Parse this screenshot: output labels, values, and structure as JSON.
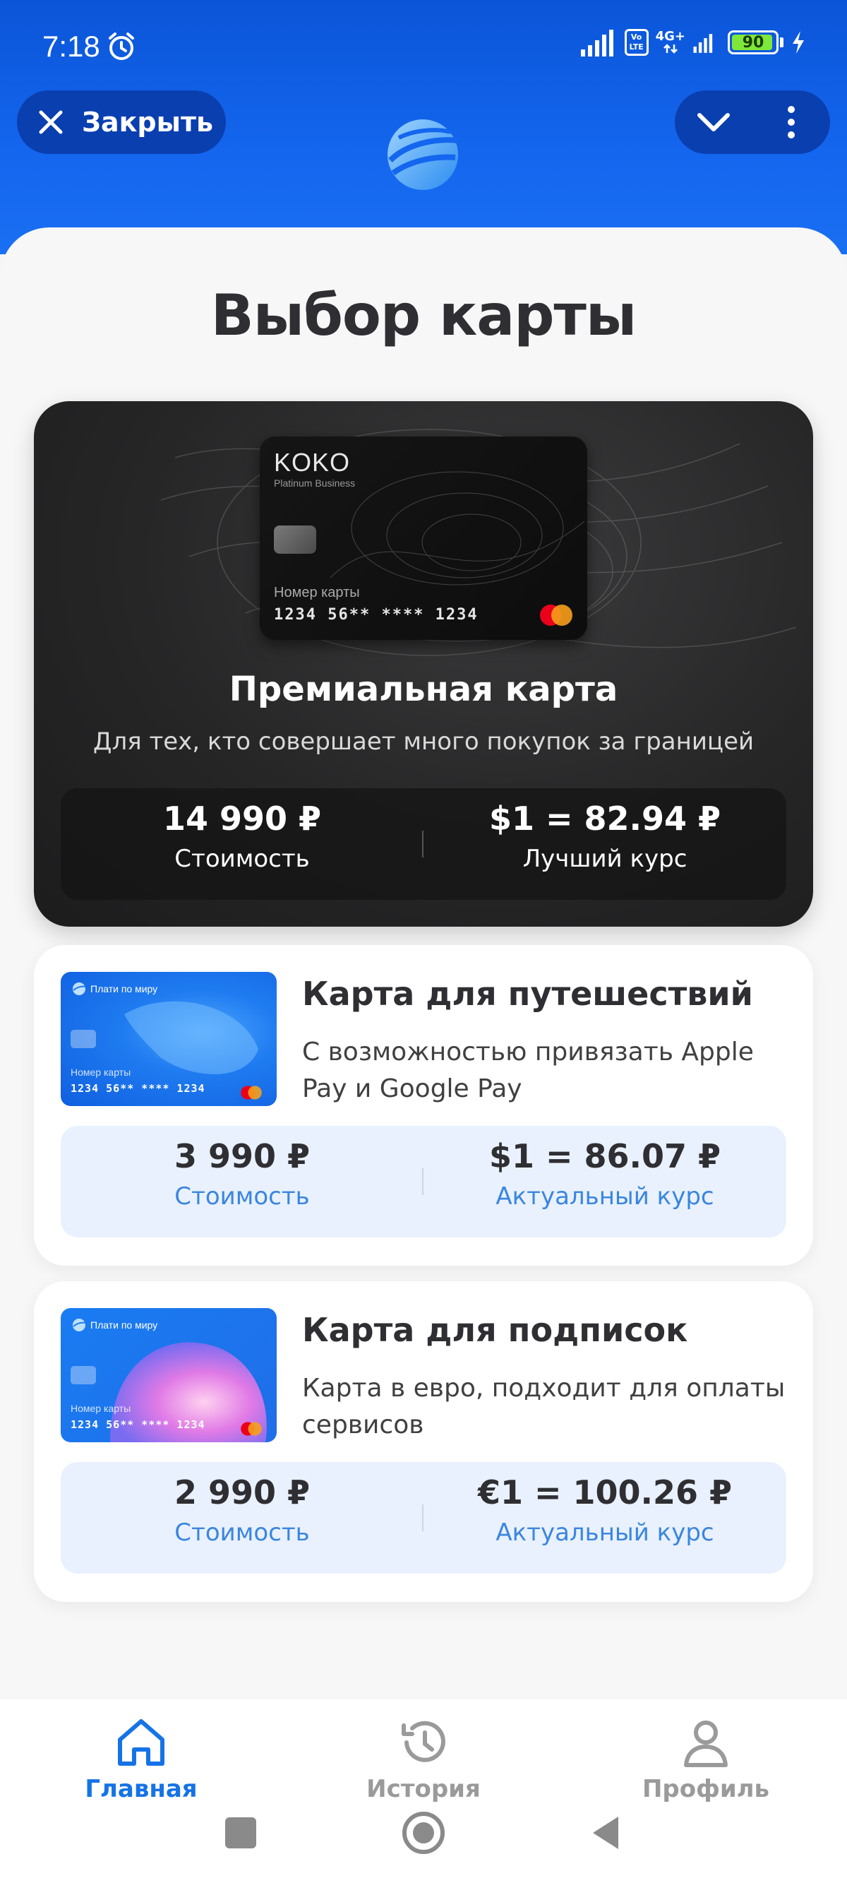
{
  "status_bar": {
    "time": "7:18",
    "network": "4G+",
    "volte": "Vo LTE",
    "battery": "90"
  },
  "header": {
    "close_label": "Закрыть",
    "accent": "#1466ee"
  },
  "page_title": "Выбор карты",
  "premium": {
    "card_brand": "KOKO",
    "card_tier": "Platinum Business",
    "card_number_label": "Номер карты",
    "card_number": "1234 56** **** 1234",
    "title": "Премиальная карта",
    "description": "Для тех, кто совершает много покупок за границей",
    "price": "14 990 ₽",
    "price_label": "Стоимость",
    "rate": "$1 = 82.94 ₽",
    "rate_label": "Лучший курс"
  },
  "offers": [
    {
      "thumb_brand": "Плати по миру",
      "thumb_number_label": "Номер карты",
      "thumb_number": "1234 56** **** 1234",
      "title": "Карта для путешествий",
      "description": "С возможностью привязать Apple Pay и Google Pay",
      "price": "3 990 ₽",
      "price_label": "Стоимость",
      "rate": "$1 = 86.07 ₽",
      "rate_label": "Актуальный курс"
    },
    {
      "thumb_brand": "Плати по миру",
      "thumb_number_label": "Номер карты",
      "thumb_number": "1234 56** **** 1234",
      "title": "Карта для подписок",
      "description": "Карта в евро, подходит для оплаты сервисов",
      "price": "2 990 ₽",
      "price_label": "Стоимость",
      "rate": "€1 = 100.26 ₽",
      "rate_label": "Актуальный курс"
    }
  ],
  "bottom_nav": {
    "items": [
      {
        "label": "Главная",
        "icon": "home-icon",
        "active": true
      },
      {
        "label": "История",
        "icon": "history-icon",
        "active": false
      },
      {
        "label": "Профиль",
        "icon": "profile-icon",
        "active": false
      }
    ],
    "active_color": "#1673e6",
    "inactive_color": "#9a9a9a"
  }
}
